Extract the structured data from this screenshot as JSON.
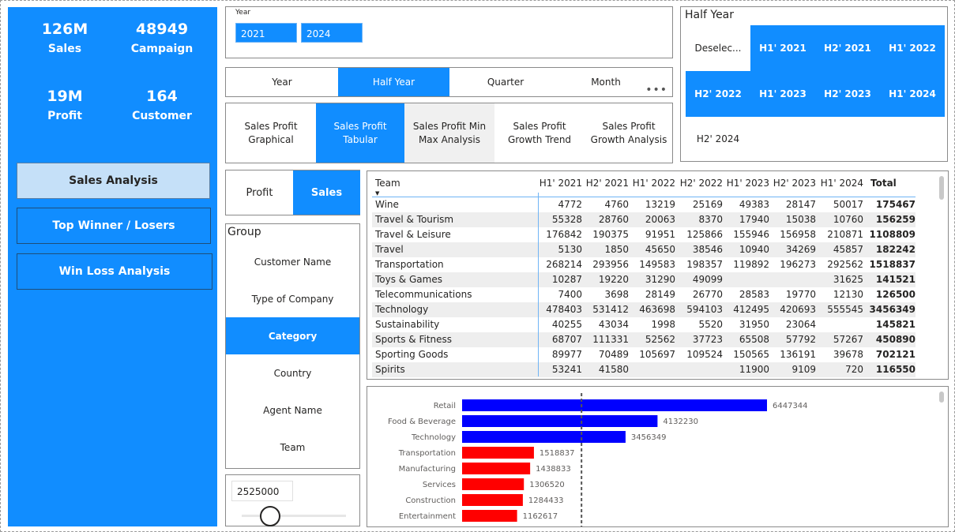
{
  "kpis": [
    {
      "value": "126M",
      "label": "Sales"
    },
    {
      "value": "48949",
      "label": "Campaign"
    },
    {
      "value": "19M",
      "label": "Profit"
    },
    {
      "value": "164",
      "label": "Customer"
    }
  ],
  "nav": {
    "sales_analysis": "Sales Analysis",
    "top_winner": "Top Winner / Losers",
    "win_loss": "Win Loss Analysis"
  },
  "year_slicer": {
    "title": "Year",
    "from": "2021",
    "to": "2024"
  },
  "period_tabs": [
    {
      "label": "Year",
      "active": false
    },
    {
      "label": "Half Year",
      "active": true
    },
    {
      "label": "Quarter",
      "active": false
    },
    {
      "label": "Month",
      "active": false
    }
  ],
  "more_label": "•••",
  "view_tabs": [
    {
      "label": "Sales Profit Graphical",
      "active": false
    },
    {
      "label": "Sales Profit Tabular",
      "active": true
    },
    {
      "label": "Sales Profit Min Max Analysis",
      "active": false
    },
    {
      "label": "Sales Profit Growth Trend",
      "active": false
    },
    {
      "label": "Sales Profit Growth Analysis",
      "active": false
    }
  ],
  "half_year": {
    "title": "Half Year",
    "items": [
      {
        "label": "Deselec...",
        "selected": false
      },
      {
        "label": "H1' 2021",
        "selected": true
      },
      {
        "label": "H2' 2021",
        "selected": true
      },
      {
        "label": "H1' 2022",
        "selected": true
      },
      {
        "label": "H2' 2022",
        "selected": true
      },
      {
        "label": "H1' 2023",
        "selected": true
      },
      {
        "label": "H2' 2023",
        "selected": true
      },
      {
        "label": "H1' 2024",
        "selected": true
      },
      {
        "label": "H2' 2024",
        "selected": false
      }
    ]
  },
  "measure_toggle": {
    "profit": "Profit",
    "sales": "Sales",
    "active": "Sales"
  },
  "group": {
    "title": "Group",
    "items": [
      "Customer Name",
      "Type of Company",
      "Category",
      "Country",
      "Agent Name",
      "Team"
    ],
    "active": "Category"
  },
  "slider": {
    "value": "2525000"
  },
  "table": {
    "columns": [
      "Team",
      "H1' 2021",
      "H2' 2021",
      "H1' 2022",
      "H2' 2022",
      "H1' 2023",
      "H2' 2023",
      "H1' 2024",
      "Total"
    ],
    "sort_icon": "▼",
    "rows": [
      [
        "Wine",
        "4772",
        "4760",
        "13219",
        "25169",
        "49383",
        "28147",
        "50017",
        "175467"
      ],
      [
        "Travel & Tourism",
        "55328",
        "28760",
        "20063",
        "8370",
        "17940",
        "15038",
        "10760",
        "156259"
      ],
      [
        "Travel & Leisure",
        "176842",
        "190375",
        "91951",
        "125866",
        "155946",
        "156958",
        "210871",
        "1108809"
      ],
      [
        "Travel",
        "5130",
        "1850",
        "45650",
        "38546",
        "10940",
        "34269",
        "45857",
        "182242"
      ],
      [
        "Transportation",
        "268214",
        "293956",
        "149583",
        "198357",
        "119892",
        "196273",
        "292562",
        "1518837"
      ],
      [
        "Toys & Games",
        "10287",
        "19220",
        "31290",
        "49099",
        "",
        "",
        "31625",
        "141521"
      ],
      [
        "Telecommunications",
        "7400",
        "3698",
        "28149",
        "26770",
        "28583",
        "19770",
        "12130",
        "126500"
      ],
      [
        "Technology",
        "478403",
        "531412",
        "463698",
        "594103",
        "412495",
        "420693",
        "555545",
        "3456349"
      ],
      [
        "Sustainability",
        "40255",
        "43034",
        "1998",
        "5520",
        "31950",
        "23064",
        "",
        "145821"
      ],
      [
        "Sports & Fitness",
        "68707",
        "111331",
        "52562",
        "37723",
        "65508",
        "57792",
        "57267",
        "450890"
      ],
      [
        "Sporting Goods",
        "89977",
        "70489",
        "105697",
        "109524",
        "150565",
        "136191",
        "39678",
        "702121"
      ],
      [
        "Spirits",
        "53241",
        "41580",
        "",
        "",
        "11900",
        "9109",
        "720",
        "116550"
      ]
    ]
  },
  "chart_data": {
    "type": "bar",
    "orientation": "horizontal",
    "categories": [
      "Retail",
      "Food & Beverage",
      "Technology",
      "Transportation",
      "Manufacturing",
      "Services",
      "Construction",
      "Entertainment"
    ],
    "values": [
      6447344,
      4132230,
      3456349,
      1518837,
      1438833,
      1306520,
      1284433,
      1162617
    ],
    "reference_line": 2525000,
    "colors": {
      "above": "#0000ff",
      "below": "#ff0000"
    },
    "data_labels": true
  },
  "colors": {
    "accent": "#118dff",
    "panel_light": "#c5e0f8"
  }
}
